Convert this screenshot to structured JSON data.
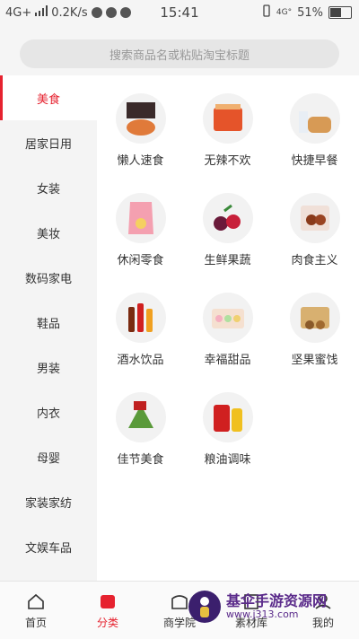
{
  "status_bar": {
    "network": "4G+",
    "speed": "0.2K/s",
    "time": "15:41",
    "signal_right": "4G°",
    "battery": "51%"
  },
  "search": {
    "placeholder": "搜索商品名或粘贴淘宝标题"
  },
  "sidebar": {
    "items": [
      {
        "label": "美食",
        "active": true
      },
      {
        "label": "居家日用"
      },
      {
        "label": "女装"
      },
      {
        "label": "美妆"
      },
      {
        "label": "数码家电"
      },
      {
        "label": "鞋品"
      },
      {
        "label": "男装"
      },
      {
        "label": "内衣"
      },
      {
        "label": "母婴"
      },
      {
        "label": "家装家纺"
      },
      {
        "label": "文娱车品"
      }
    ]
  },
  "categories": [
    {
      "label": "懒人速食",
      "icon": "instant-noodles-icon"
    },
    {
      "label": "无辣不欢",
      "icon": "spicy-snack-icon"
    },
    {
      "label": "快捷早餐",
      "icon": "bread-milk-icon"
    },
    {
      "label": "休闲零食",
      "icon": "chips-bag-icon"
    },
    {
      "label": "生鲜果蔬",
      "icon": "fresh-fruit-icon"
    },
    {
      "label": "肉食主义",
      "icon": "meat-icon"
    },
    {
      "label": "酒水饮品",
      "icon": "drinks-icon"
    },
    {
      "label": "幸福甜品",
      "icon": "macaron-icon"
    },
    {
      "label": "坚果蜜饯",
      "icon": "nuts-box-icon"
    },
    {
      "label": "佳节美食",
      "icon": "zongzi-icon"
    },
    {
      "label": "粮油调味",
      "icon": "rice-oil-icon"
    }
  ],
  "bottom_nav": [
    {
      "label": "首页",
      "icon": "home-icon"
    },
    {
      "label": "分类",
      "icon": "category-icon",
      "active": true
    },
    {
      "label": "商学院",
      "icon": "store-icon"
    },
    {
      "label": "素材库",
      "icon": "library-icon"
    },
    {
      "label": "我的",
      "icon": "user-icon"
    }
  ],
  "watermark": {
    "title": "基伞手游资源网",
    "url": "www.j313.com"
  },
  "colors": {
    "accent": "#e6222f"
  }
}
